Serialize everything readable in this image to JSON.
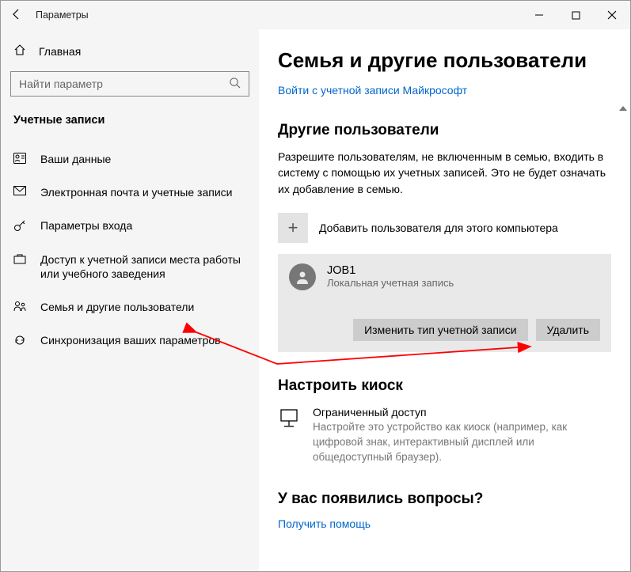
{
  "titlebar": {
    "title": "Параметры"
  },
  "sidebar": {
    "home": "Главная",
    "search_placeholder": "Найти параметр",
    "section": "Учетные записи",
    "items": [
      {
        "label": "Ваши данные"
      },
      {
        "label": "Электронная почта и учетные записи"
      },
      {
        "label": "Параметры входа"
      },
      {
        "label": "Доступ к учетной записи места работы или учебного заведения"
      },
      {
        "label": "Семья и другие пользователи"
      },
      {
        "label": "Синхронизация ваших параметров"
      }
    ]
  },
  "main": {
    "title": "Семья и другие пользователи",
    "signin_link": "Войти с учетной записи Майкрософт",
    "other_users": {
      "heading": "Другие пользователи",
      "desc": "Разрешите пользователям, не включенным в семью, входить в систему с помощью их учетных записей. Это не будет означать их добавление в семью.",
      "add_label": "Добавить пользователя для этого компьютера"
    },
    "user": {
      "name": "JOB1",
      "type": "Локальная учетная запись",
      "change_type_btn": "Изменить тип учетной записи",
      "remove_btn": "Удалить"
    },
    "kiosk": {
      "heading": "Настроить киоск",
      "title": "Ограниченный доступ",
      "desc": "Настройте это устройство как киоск (например, как цифровой знак, интерактивный дисплей или общедоступный браузер)."
    },
    "questions": {
      "heading": "У вас появились вопросы?",
      "help_link": "Получить помощь"
    }
  }
}
